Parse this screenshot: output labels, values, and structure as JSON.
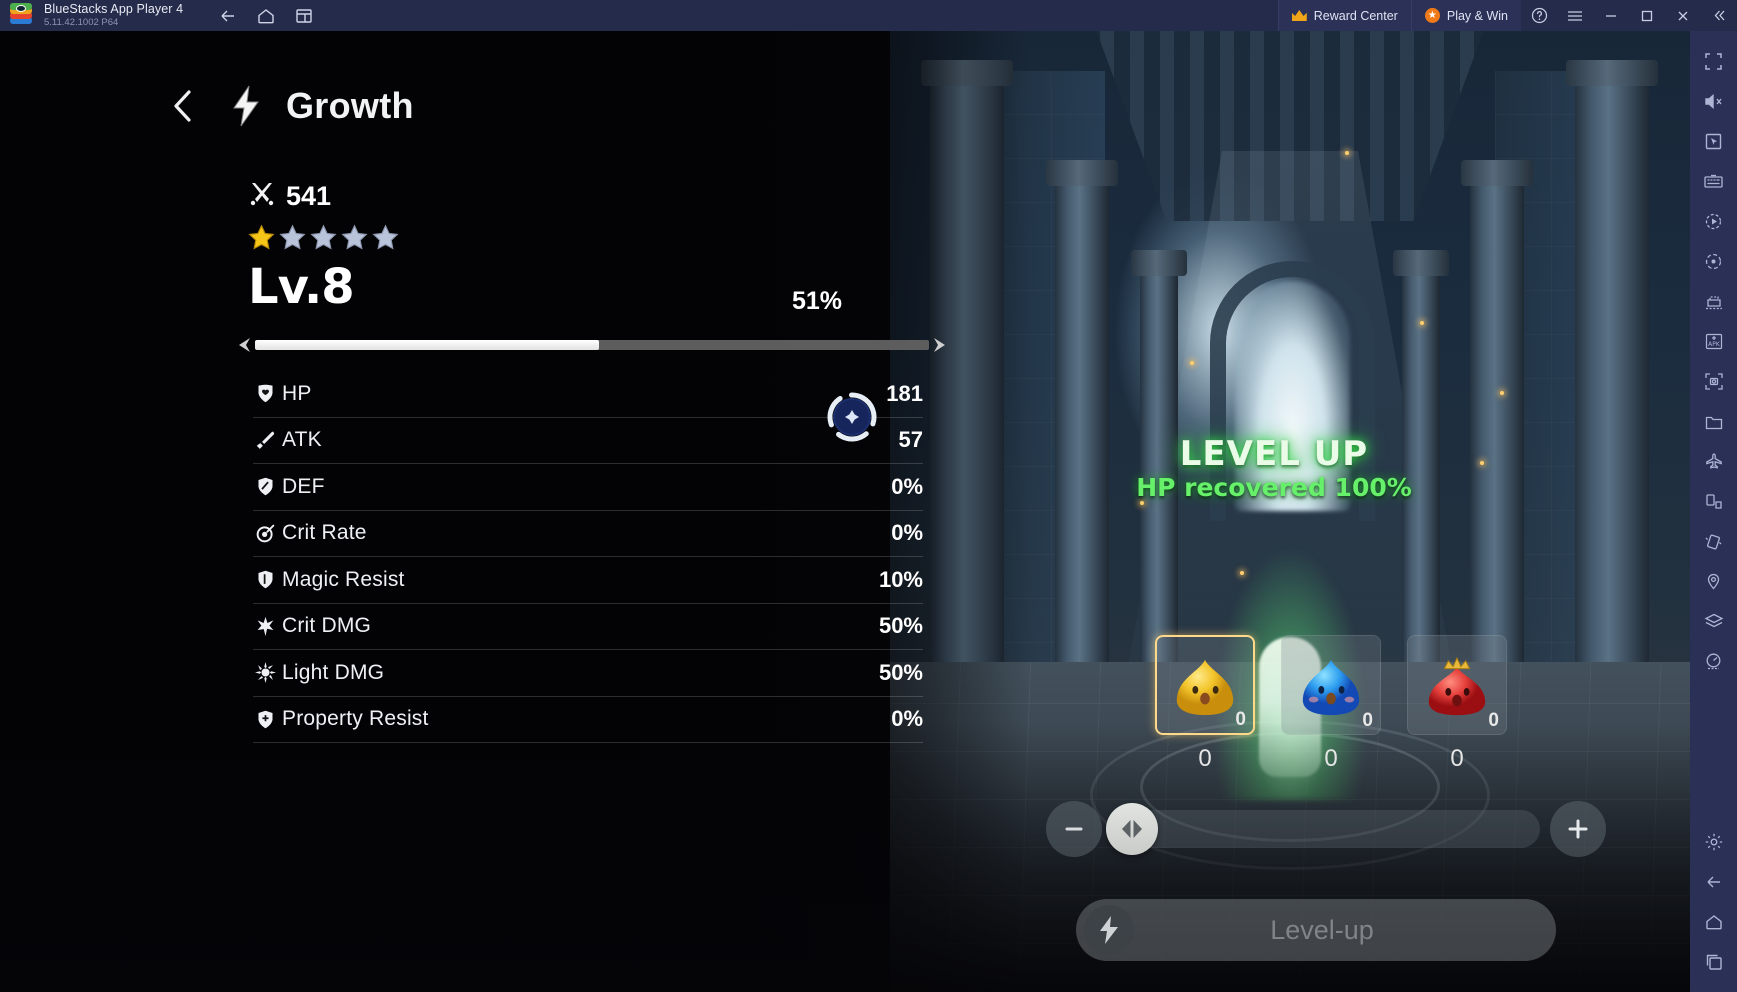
{
  "titlebar": {
    "app_name": "BlueStacks App Player 4",
    "version": "5.11.42.1002  P64",
    "logo_icon": "bluestacks-logo",
    "nav": [
      {
        "name": "back-arrow-icon",
        "label": "Back"
      },
      {
        "name": "home-icon",
        "label": "Home"
      },
      {
        "name": "multi-instance-icon",
        "label": "Instances"
      }
    ],
    "reward_center": "Reward Center",
    "reward_icon": "crown-icon",
    "play_win": "Play & Win",
    "play_win_icon": "star-badge-icon",
    "help_icon": "question-mark-icon",
    "menu_icon": "hamburger-menu-icon",
    "minimize_icon": "minimize-icon",
    "maximize_icon": "maximize-icon",
    "close_icon": "close-icon",
    "collapse_icon": "double-chevron-left-icon"
  },
  "sidebar": {
    "items": [
      {
        "name": "fullscreen-icon",
        "label": "Fullscreen"
      },
      {
        "name": "mute-icon",
        "label": "Mute"
      },
      {
        "name": "cursor-icon",
        "label": "Cursor"
      },
      {
        "name": "keyboard-icon",
        "label": "Game controls"
      },
      {
        "name": "macro-record-icon",
        "label": "Macro recorder"
      },
      {
        "name": "script-icon",
        "label": "Script"
      },
      {
        "name": "multi-instance-manager-icon",
        "label": "Multi-instance manager"
      },
      {
        "name": "install-apk-icon",
        "label": "Install APK"
      },
      {
        "name": "screenshot-icon",
        "label": "Screenshot"
      },
      {
        "name": "media-manager-icon",
        "label": "Media manager"
      },
      {
        "name": "airplane-icon",
        "label": "Airplane mode"
      },
      {
        "name": "rotate-screen-icon",
        "label": "Rotate"
      },
      {
        "name": "shake-icon",
        "label": "Shake"
      },
      {
        "name": "location-icon",
        "label": "Location"
      },
      {
        "name": "layers-icon",
        "label": "Layers"
      },
      {
        "name": "performance-icon",
        "label": "Performance"
      },
      {
        "name": "settings-gear-icon",
        "label": "Settings"
      },
      {
        "name": "back-arrow-icon",
        "label": "Back"
      },
      {
        "name": "home-icon",
        "label": "Home"
      },
      {
        "name": "recent-apps-icon",
        "label": "Recent apps"
      }
    ]
  },
  "game": {
    "header": {
      "back_icon": "back-chevron-icon",
      "title_icon": "lightning-bolt-icon",
      "title": "Growth"
    },
    "power": {
      "icon": "crossed-swords-icon",
      "value": "541"
    },
    "stars": {
      "total": 5,
      "filled": 1
    },
    "level": {
      "label": "Lv.8",
      "percent_label": "51%",
      "progress": 51,
      "arrow_left_icon": "arrow-left-icon",
      "arrow_right_icon": "arrow-right-icon"
    },
    "stats": [
      {
        "icon": "heart-shield-icon",
        "label": "HP",
        "value": "181"
      },
      {
        "icon": "sword-icon",
        "label": "ATK",
        "value": "57"
      },
      {
        "icon": "shield-icon",
        "label": "DEF",
        "value": "0%"
      },
      {
        "icon": "target-icon",
        "label": "Crit Rate",
        "value": "0%"
      },
      {
        "icon": "magic-shield-icon",
        "label": "Magic Resist",
        "value": "10%"
      },
      {
        "icon": "burst-icon",
        "label": "Crit DMG",
        "value": "50%"
      },
      {
        "icon": "sun-icon",
        "label": "Light DMG",
        "value": "50%"
      },
      {
        "icon": "property-shield-icon",
        "label": "Property Resist",
        "value": "0%"
      }
    ],
    "hp_orb_icon": "hp-stat-orb-icon",
    "levelup_banner": {
      "title": "LEVEL UP",
      "subtitle": "HP recovered 100%"
    },
    "materials": [
      {
        "name": "gold-slime",
        "badge": "0",
        "count": "0",
        "selected": true,
        "color": "#f2c32a",
        "crown": false
      },
      {
        "name": "blue-slime",
        "badge": "0",
        "count": "0",
        "selected": false,
        "color": "#2e9ef0",
        "crown": false
      },
      {
        "name": "red-slime",
        "badge": "0",
        "count": "0",
        "selected": false,
        "color": "#e5403c",
        "crown": true
      }
    ],
    "stepper": {
      "minus_icon": "minus-icon",
      "plus_icon": "plus-icon",
      "knob_icon": "left-right-arrows-icon"
    },
    "action_button": {
      "icon": "lightning-bolt-icon",
      "label": "Level-up"
    }
  },
  "colors": {
    "titlebar_bg": "#252b4a",
    "sidebar_bg": "#2b3156",
    "accent_orange": "#f0a518",
    "levelup_green": "#67f06a",
    "selected_border": "#ffd98a"
  }
}
